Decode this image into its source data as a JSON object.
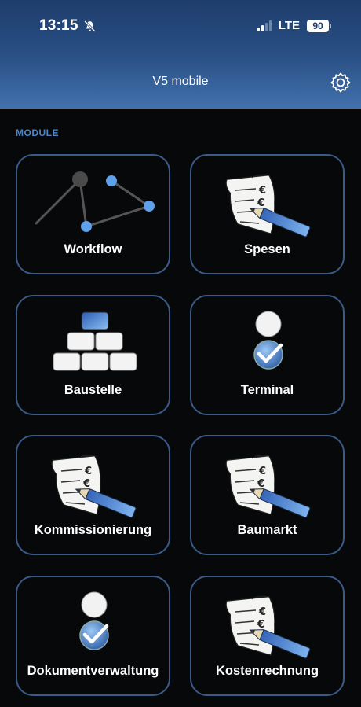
{
  "status_bar": {
    "time": "13:15",
    "network": "LTE",
    "battery": "90"
  },
  "header": {
    "title": "V5 mobile"
  },
  "section": {
    "label": "MODULE"
  },
  "modules": [
    {
      "label": "Workflow",
      "icon": "workflow-graph-icon"
    },
    {
      "label": "Spesen",
      "icon": "document-pen-icon"
    },
    {
      "label": "Baustelle",
      "icon": "bricks-icon"
    },
    {
      "label": "Terminal",
      "icon": "user-check-icon"
    },
    {
      "label": "Kommissionierung",
      "icon": "document-pen-icon"
    },
    {
      "label": "Baumarkt",
      "icon": "document-pen-icon"
    },
    {
      "label": "Dokumentverwaltung",
      "icon": "user-check-icon"
    },
    {
      "label": "Kostenrechnung",
      "icon": "document-pen-icon"
    }
  ],
  "colors": {
    "accent": "#4f86c8",
    "header_top": "#1e3d6c",
    "header_bottom": "#4271ad",
    "tile_border": "#3a5a88",
    "background": "#07080a"
  }
}
